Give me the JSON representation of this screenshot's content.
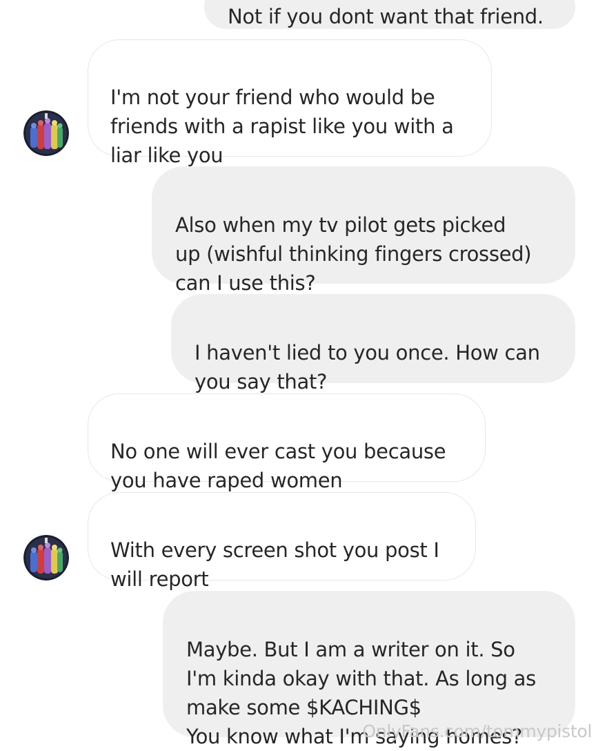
{
  "messages": [
    {
      "side": "out",
      "text": "Not if you dont want that friend."
    },
    {
      "side": "in",
      "text": "I'm not your friend who would be\nfriends with a rapist like you with a\nliar like you"
    },
    {
      "side": "out",
      "text": "Also when my tv pilot gets picked\nup (wishful thinking fingers crossed)\ncan I use this?"
    },
    {
      "side": "out",
      "text": "I haven't lied to you once. How can\nyou say that?"
    },
    {
      "side": "in",
      "text": "No one will ever cast you because\nyou have raped women"
    },
    {
      "side": "in",
      "text": "With every screen shot you post I\nwill report"
    },
    {
      "side": "out",
      "text": "Maybe. But I am a writer on it. So\nI'm kinda okay with that. As long as\nmake some $KACHING$\nYou know what I'm saying homes?"
    }
  ],
  "watermark": "OnlyFans.com/tommypistol",
  "avatar_icon": "power-rangers-avatar-icon",
  "colors": {
    "outgoing_bubble": "#efefef",
    "incoming_border": "#e6e6e6",
    "text": "#262626",
    "watermark": "#c8c8c8"
  }
}
